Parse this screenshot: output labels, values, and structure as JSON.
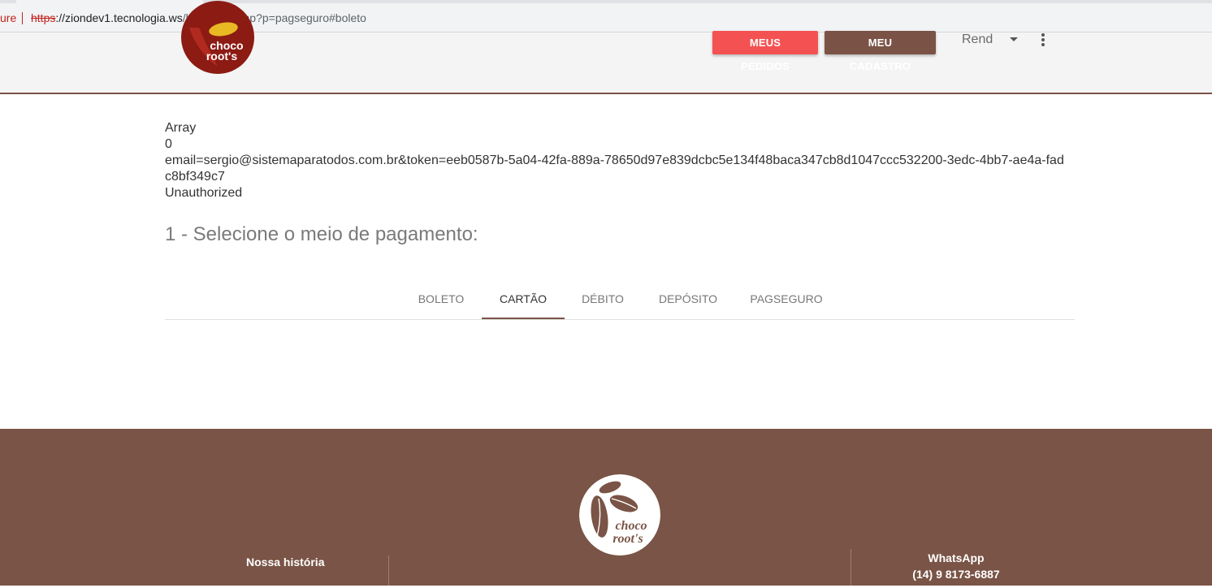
{
  "browser": {
    "secure_label": "ure",
    "url_protocol": "https",
    "url_host": "://ziondev1.tecnologia.ws",
    "url_path": "/loja/index.php?p=pagseguro#boleto"
  },
  "header": {
    "logo_text_line1": "choco",
    "logo_text_line2": "root's",
    "orders_button": "MEUS PEDIDOS",
    "profile_button": "MEU CADASTRO",
    "user_name": "Rend"
  },
  "debug_output": {
    "line1": "Array",
    "line2": "0",
    "line3": "email=sergio@sistemaparatodos.com.br&token=eeb0587b-5a04-42fa-889a-78650d97e839dcbc5e134f48baca347cb8d1047ccc532200-3edc-4bb7-ae4a-fadc8bf349c7",
    "line4": "Unauthorized"
  },
  "payment": {
    "title": "1 - Selecione o meio de pagamento:",
    "tabs": [
      {
        "label": "BOLETO"
      },
      {
        "label": "CARTÃO"
      },
      {
        "label": "DÉBITO"
      },
      {
        "label": "DEPÓSITO"
      },
      {
        "label": "PAGSEGURO"
      }
    ],
    "active_tab": "CARTÃO"
  },
  "footer": {
    "history_label": "Nossa história",
    "whatsapp_label": "WhatsApp",
    "whatsapp_number": "(14) 9 8173-6887",
    "logo_text_line1": "choco",
    "logo_text_line2": "root's"
  },
  "colors": {
    "brand_brown": "#7a5346",
    "accent_red": "#f45252",
    "footer_bg": "#7a5446"
  }
}
